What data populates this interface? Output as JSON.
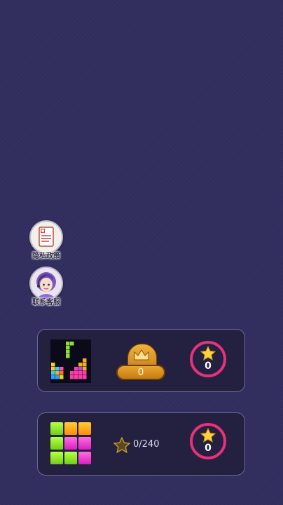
{
  "side_buttons": [
    {
      "label": "隐私政策",
      "icon": "document-icon"
    },
    {
      "label": "联系客服",
      "icon": "customer-service-avatar-icon"
    }
  ],
  "modes": [
    {
      "name": "tetris-mode",
      "thumbnail_icon": "tetris-board-icon",
      "crown_score": "0",
      "stars": "0"
    },
    {
      "name": "block-puzzle-mode",
      "thumbnail_icon": "block-grid-icon",
      "star_progress": "0/240",
      "stars": "0"
    }
  ],
  "colors": {
    "background": "#302d5e",
    "card": "#23213f",
    "ring": "#e6317b",
    "gold": "#e9a531"
  }
}
